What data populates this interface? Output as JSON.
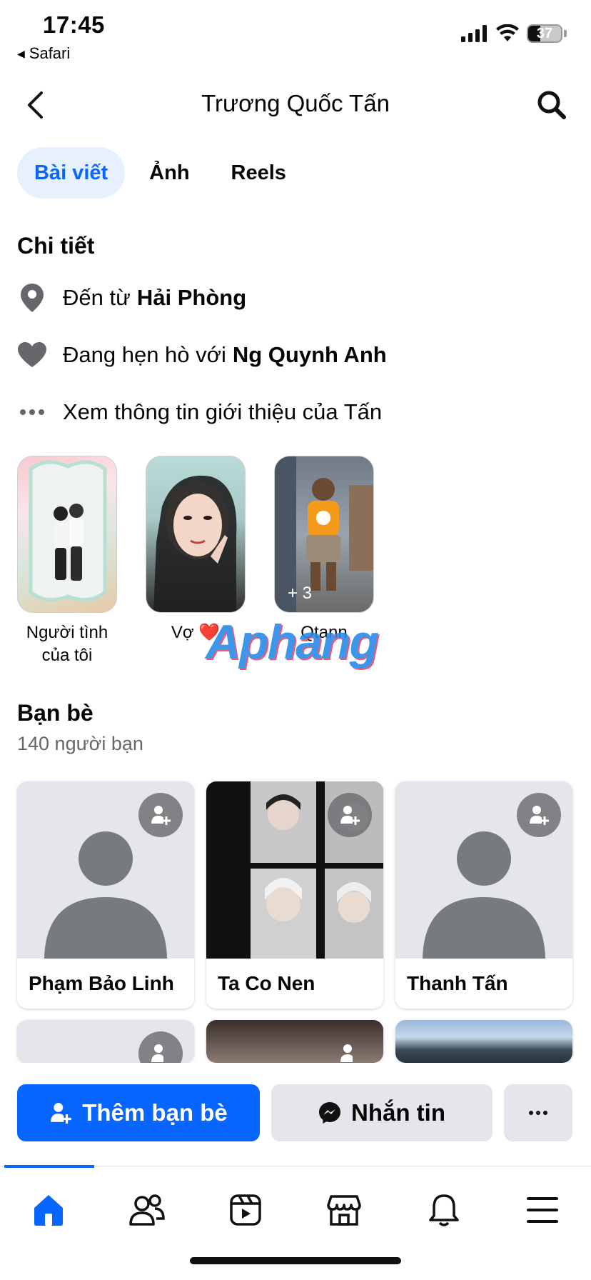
{
  "status_bar": {
    "time": "17:45",
    "back_app": "Safari",
    "battery": "37"
  },
  "header": {
    "title": "Trương Quốc Tấn"
  },
  "tabs": [
    {
      "label": "Bài viết",
      "active": true
    },
    {
      "label": "Ảnh",
      "active": false
    },
    {
      "label": "Reels",
      "active": false
    }
  ],
  "details": {
    "title": "Chi tiết",
    "hometown_prefix": "Đến từ",
    "hometown": "Hải Phòng",
    "relationship_prefix": "Đang hẹn hò với",
    "partner": "Ng Quynh Anh",
    "see_about": "Xem thông tin giới thiệu của Tấn"
  },
  "highlights": [
    {
      "label": "Người tình của tôi"
    },
    {
      "label": "Vợ ❤️"
    },
    {
      "label": "Qtann",
      "extra_count": "+ 3"
    }
  ],
  "watermark": "Aphang",
  "friends": {
    "title": "Bạn bè",
    "count_text": "140 người bạn",
    "items": [
      {
        "name": "Phạm Bảo Linh"
      },
      {
        "name": "Ta Co Nen"
      },
      {
        "name": "Thanh Tấn"
      }
    ]
  },
  "actions": {
    "add_friend": "Thêm bạn bè",
    "message": "Nhắn tin"
  },
  "colors": {
    "accent": "#0866ff",
    "tab_active_bg": "#e7f0fd",
    "secondary_button": "#e4e6eb",
    "muted_text": "#65676b"
  },
  "nav": [
    "home-icon",
    "friends-icon",
    "video-icon",
    "marketplace-icon",
    "bell-icon",
    "menu-icon"
  ]
}
